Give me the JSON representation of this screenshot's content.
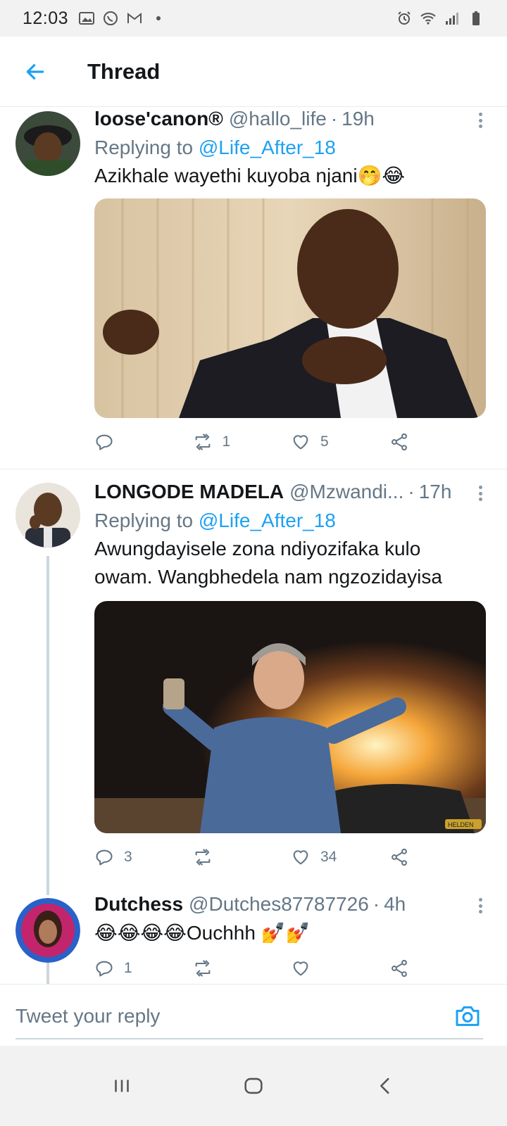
{
  "status_bar": {
    "time": "12:03",
    "left_icons": [
      "gallery-icon",
      "whatsapp-icon",
      "gmail-icon",
      "dot-icon"
    ],
    "right_icons": [
      "alarm-icon",
      "wifi-icon",
      "signal-icon",
      "battery-icon"
    ]
  },
  "header": {
    "back_icon": "arrow-left-icon",
    "title": "Thread"
  },
  "tweets": [
    {
      "name": "loose'canon®",
      "handle": "@hallo_life",
      "separator": "·",
      "time": "19h",
      "replying_prefix": "Replying to",
      "replying_to": "@Life_After_18",
      "text": "Azikhale wayethi kuyoba njani🤭😂",
      "media_description_icon": "photo-man-gesturing",
      "reply_count": "",
      "retweet_count": "1",
      "like_count": "5"
    },
    {
      "name": "LONGODE MADELA",
      "handle": "@Mzwandi...",
      "separator": "·",
      "time": "17h",
      "replying_prefix": "Replying to",
      "replying_to": "@Life_After_18",
      "text_line1": "Awungdayisele zona ndiyozifaka kulo",
      "text_line2": "owam. Wangbhedela nam ngzozidayisa",
      "media_description_icon": "photo-man-fire",
      "watermark": "HELDEN",
      "reply_count": "3",
      "retweet_count": "",
      "like_count": "34"
    },
    {
      "name": "Dutchess",
      "handle": "@Dutches87787726",
      "separator": "·",
      "time": "4h",
      "text": "😂😂😂😂Ouchhh 💅💅",
      "reply_count": "1",
      "retweet_count": "",
      "like_count": ""
    }
  ],
  "composer": {
    "placeholder": "Tweet your reply",
    "camera_icon": "camera-icon"
  },
  "nav": {
    "icons": [
      "recents-icon",
      "home-icon",
      "back-icon"
    ]
  },
  "colors": {
    "accent": "#1da1f2",
    "secondary_text": "#657786",
    "primary_text": "#14171a",
    "divider": "#e6ecf0"
  }
}
